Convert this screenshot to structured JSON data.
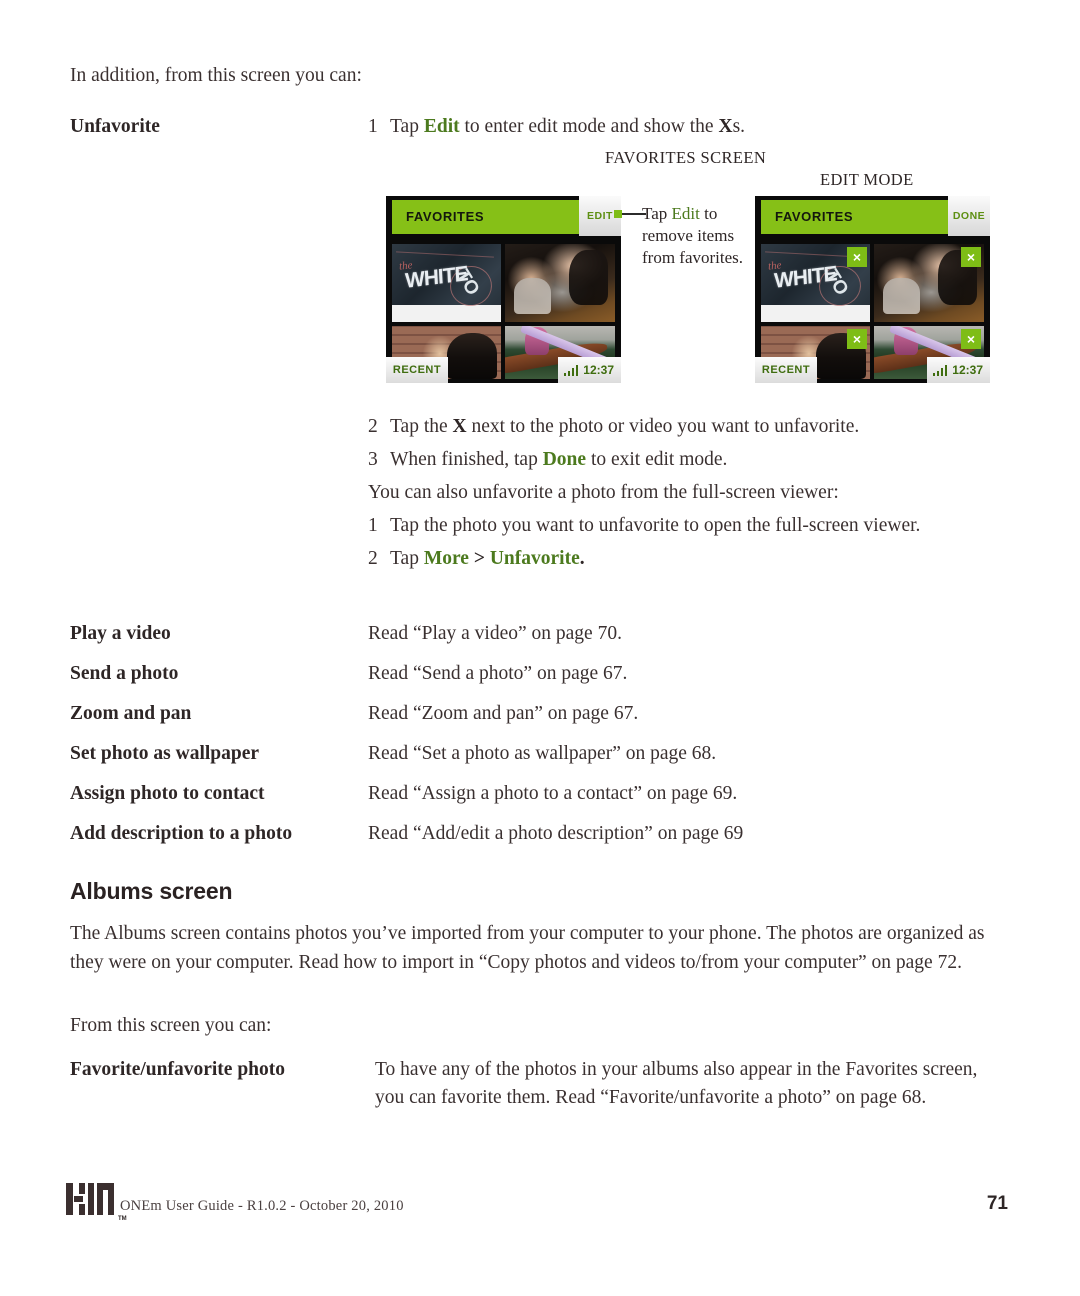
{
  "intro": {
    "line": "In addition, from this screen you can:"
  },
  "unfavorite": {
    "term": "Unfavorite",
    "step1": {
      "num": "1",
      "pre": "Tap ",
      "kw": "Edit",
      "post": " to enter edit mode and show the ",
      "kw2": "X",
      "tail": "s."
    },
    "step2": {
      "num": "2",
      "pre": "Tap the ",
      "kw": "X",
      "post": " next to the photo or video you want to unfavorite."
    },
    "step3": {
      "num": "3",
      "pre": "When finished, tap ",
      "kw": "Done",
      "post": " to exit edit mode."
    },
    "note": "You can also unfavorite a photo from the full-screen viewer:",
    "step4": {
      "num": "1",
      "text": "Tap the photo you want to unfavorite to open the full-screen viewer."
    },
    "step5": {
      "num": "2",
      "pre": "Tap ",
      "kw": "More",
      "mid": " > ",
      "kw2": "Unfavorite",
      "post": "."
    }
  },
  "figure": {
    "caption_left": "FAVORITES SCREEN",
    "caption_right": "EDIT MODE",
    "callout": {
      "line1_pre": "Tap ",
      "line1_kw": "Edit",
      "line1_post": " to",
      "line2": "remove items",
      "line3": "from favorites."
    },
    "phone_left": {
      "title": "FAVORITES",
      "action_button": "EDIT",
      "recent_tab": "RECENT",
      "clock": "12:37"
    },
    "phone_right": {
      "title": "FAVORITES",
      "action_button": "DONE",
      "recent_tab": "RECENT",
      "clock": "12:37",
      "remove_badge": "×"
    },
    "photos": {
      "chalk_the": "the",
      "chalk_white": "WHITE",
      "chalk_to": "TO"
    },
    "colors": {
      "green_header": "#86c017",
      "green_badge": "#7ebd16",
      "green_text": "#5d8f12"
    }
  },
  "definitions": [
    {
      "term": "Play a video",
      "desc": "Read “Play a video” on page 70."
    },
    {
      "term": "Send a photo",
      "desc": "Read “Send a photo” on page 67."
    },
    {
      "term": "Zoom and pan",
      "desc": "Read “Zoom and pan” on page 67."
    },
    {
      "term": "Set photo as wallpaper",
      "desc": "Read “Set a photo as wallpaper” on page 68."
    },
    {
      "term": "Assign photo to contact",
      "desc": "Read “Assign a photo to a contact” on page 69."
    },
    {
      "term": "Add description to a photo",
      "desc": "Read “Add/edit a photo description” on page 69"
    }
  ],
  "albums": {
    "heading": "Albums screen",
    "paragraph": "The Albums screen contains photos you’ve imported from your computer to your phone. The photos are organized as they were on your computer. Read how to import in “Copy photos and videos to/from your computer” on page 72.",
    "from_line": "From this screen you can:",
    "definitions": [
      {
        "term": "Favorite/unfavorite photo",
        "desc": "To have any of the photos in your albums also appear in the Favorites screen, you can favorite them. Read “Favorite/unfavorite a photo” on page 68."
      }
    ]
  },
  "footer": {
    "logo": "KIN",
    "trademark": "TM",
    "text": "ONEm User Guide - R1.0.2 - October 20, 2010",
    "page_number": "71"
  }
}
